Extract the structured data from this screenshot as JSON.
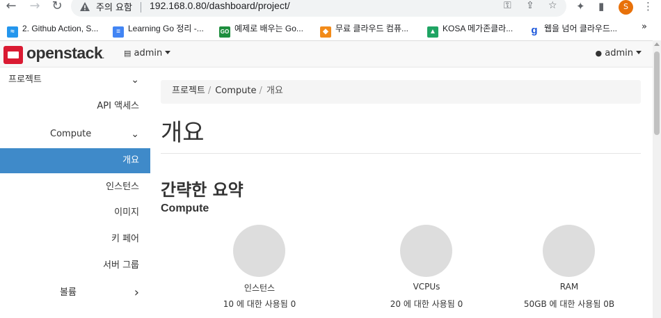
{
  "browser": {
    "security_warning": "주의 요함",
    "url": "192.168.0.80/dashboard/project/",
    "profile_initial": "S",
    "bookmarks": [
      {
        "label": "2. Github Action, S...",
        "icon": "docker-whale-icon",
        "color": "#2496ed"
      },
      {
        "label": "Learning Go 정리 -...",
        "icon": "google-docs-icon",
        "color": "#4285f4"
      },
      {
        "label": "예제로 배우는 Go...",
        "icon": "go-logo-icon",
        "color": "#1e8e3e"
      },
      {
        "label": "무료 클라우드 컴퓨...",
        "icon": "aws-box-icon",
        "color": "#f28b1a"
      },
      {
        "label": "KOSA 메가존클라...",
        "icon": "google-drive-icon",
        "color": "#1fa463"
      },
      {
        "label": "웹을 넘어 클라우드...",
        "icon": "g-letter-icon",
        "color": "#1a56db"
      }
    ],
    "bookmarks_overflow": "»"
  },
  "header": {
    "logo_text": "openstack",
    "project_selector": "admin",
    "user_menu": "admin"
  },
  "sidebar": {
    "items": [
      {
        "label": "프로젝트",
        "chevron": "⌄"
      },
      {
        "label": "API 액세스"
      },
      {
        "label": "Compute",
        "chevron": "⌄"
      },
      {
        "label": "개요"
      },
      {
        "label": "인스턴스"
      },
      {
        "label": "이미지"
      },
      {
        "label": "키 페어"
      },
      {
        "label": "서버 그룹"
      },
      {
        "label": "볼륨",
        "chevron": "›"
      }
    ]
  },
  "main": {
    "breadcrumb": [
      {
        "label": "프로젝트"
      },
      {
        "label": "Compute"
      },
      {
        "label": "개요"
      }
    ],
    "page_title": "개요",
    "section_title": "간략한 요약",
    "subsection_title": "Compute",
    "pies": [
      {
        "title": "인스턴스",
        "desc": "10 에 대한 사용됨 0",
        "used": 0,
        "limit": 10
      },
      {
        "title": "VCPUs",
        "desc": "20 에 대한 사용됨 0",
        "used": 0,
        "limit": 20
      },
      {
        "title": "RAM",
        "desc": "50GB 에 대한 사용됨 0B",
        "used": 0,
        "limit": 50
      }
    ]
  },
  "colors": {
    "accent": "#3f8ac9",
    "brand_red": "#da1a32"
  }
}
